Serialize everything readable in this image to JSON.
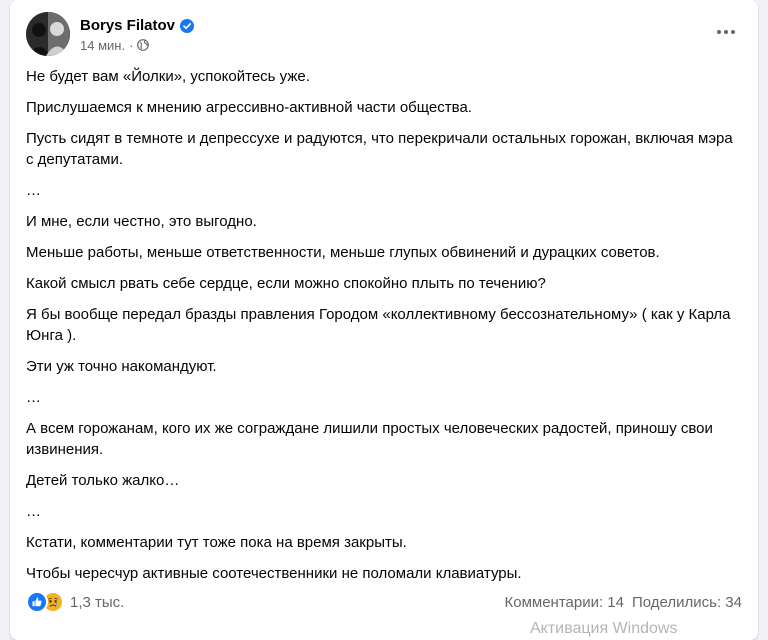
{
  "post": {
    "author": "Borys Filatov",
    "time": "14 мин.",
    "separator": "·",
    "paragraphs": [
      "Не будет вам «Йолки», успокойтесь уже.",
      "Прислушаемся к мнению агрессивно-активной части общества.",
      "Пусть сидят в темноте и депрессухе и радуются, что перекричали остальных горожан, включая мэра с депутатами.",
      "…",
      "И мне, если честно, это выгодно.",
      "Меньше работы, меньше ответственности, меньше глупых обвинений и дурацких советов.",
      "Какой смысл рвать себе сердце, если можно спокойно плыть по течению?",
      "Я бы вообще передал бразды правления Городом «коллективному бессознательному» ( как у Карла Юнга ).",
      "Эти уж точно накомандуют.",
      "…",
      "А всем горожанам, кого их же сограждане лишили простых человеческих радостей, приношу свои извинения.",
      "Детей только жалко…",
      "…",
      "Кстати, комментарии тут тоже пока на время закрыты.",
      "Чтобы чересчур активные соотечественники не поломали клавиатуры."
    ]
  },
  "footer": {
    "reactions_count": "1,3 тыс.",
    "comments": "Комментарии: 14",
    "shares": "Поделились: 34"
  },
  "watermark": "Активация Windows",
  "icons": {
    "verified": "verified-badge-icon",
    "audience": "globe-icon",
    "more": "more-options-icon",
    "like": "like-reaction-icon",
    "sad": "sad-reaction-icon"
  },
  "colors": {
    "accent": "#1877f2",
    "secondary_text": "#65676b",
    "sad": "#f7b125"
  }
}
